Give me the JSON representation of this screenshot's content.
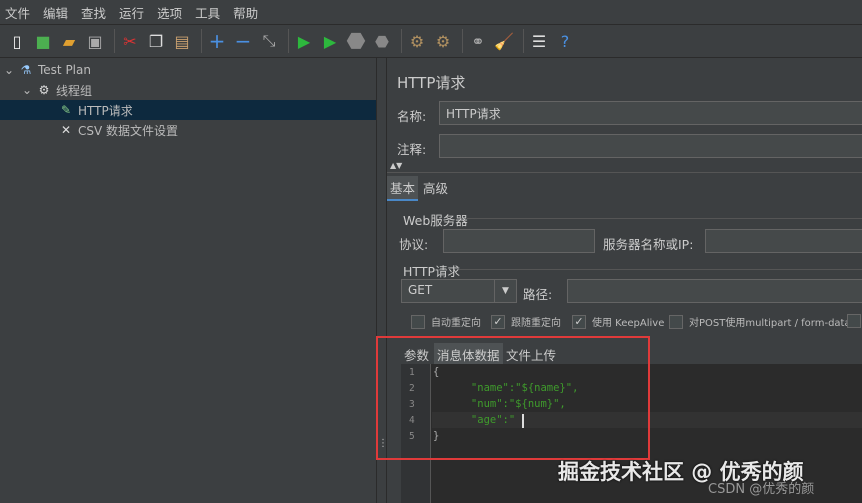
{
  "menu": [
    "文件",
    "编辑",
    "查找",
    "运行",
    "选项",
    "工具",
    "帮助"
  ],
  "toolbar": [
    "new-icon",
    "templates-icon",
    "open-icon",
    "save-icon",
    "cut-icon",
    "copy-icon",
    "paste-icon",
    "expand-icon",
    "collapse-icon",
    "toggle-icon",
    "start-icon",
    "start-no-pause-icon",
    "stop-icon",
    "shutdown-icon",
    "clear-icon",
    "clear-all-icon",
    "search-icon",
    "reset-search-icon",
    "function-helper-icon",
    "help-icon"
  ],
  "tree": {
    "test_plan": "Test Plan",
    "thread_group": "线程组",
    "http_request": "HTTP请求",
    "csv": "CSV 数据文件设置"
  },
  "panel": {
    "title": "HTTP请求",
    "name_label": "名称:",
    "name_value": "HTTP请求",
    "comment_label": "注释:",
    "tab_basic": "基本",
    "tab_advanced": "高级",
    "web_server": "Web服务器",
    "protocol_label": "协议:",
    "server_label": "服务器名称或IP:",
    "http_request": "HTTP请求",
    "method": "GET",
    "path_label": "路径:",
    "checkboxes": [
      {
        "label": "自动重定向",
        "checked": false
      },
      {
        "label": "跟随重定向",
        "checked": true
      },
      {
        "label": "使用 KeepAlive",
        "checked": true
      },
      {
        "label": "对POST使用multipart / form-data",
        "checked": false
      }
    ],
    "subtabs": [
      "参数",
      "消息体数据",
      "文件上传"
    ],
    "lines": [
      "1",
      "2",
      "3",
      "4",
      "5"
    ],
    "code": [
      "{",
      "      \"name\":\"${name}\",",
      "      \"num\":\"${num}\",",
      "      \"age\":\"",
      "}"
    ]
  },
  "watermark": "掘金技术社区 @ 优秀的颜",
  "watermark2": "CSDN @优秀的颜"
}
